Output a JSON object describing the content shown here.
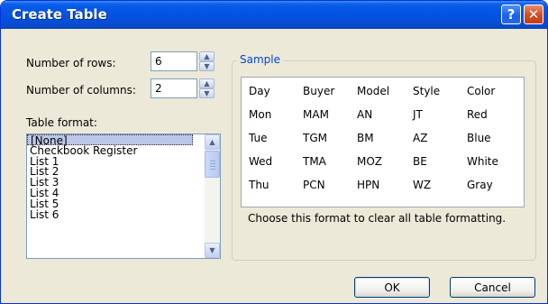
{
  "window": {
    "title": "Create Table",
    "help_label": "?",
    "close_label": "✕"
  },
  "rows": {
    "label": "Number of rows:",
    "value": "6"
  },
  "columns": {
    "label": "Number of columns:",
    "value": "2"
  },
  "table_format": {
    "label": "Table format:",
    "items": [
      "[None]",
      "Checkbook Register",
      "List 1",
      "List 2",
      "List 3",
      "List 4",
      "List 5",
      "List 6"
    ],
    "selected": "[None]"
  },
  "sample": {
    "title": "Sample",
    "grid": [
      [
        "Day",
        "Buyer",
        "Model",
        "Style",
        "Color"
      ],
      [
        "Mon",
        "MAM",
        "AN",
        "JT",
        "Red"
      ],
      [
        "Tue",
        "TGM",
        "BM",
        "AZ",
        "Blue"
      ],
      [
        "Wed",
        "TMA",
        "MOZ",
        "BE",
        "White"
      ],
      [
        "Thu",
        "PCN",
        "HPN",
        "WZ",
        "Gray"
      ]
    ],
    "description": "Choose this format to clear all table formatting."
  },
  "buttons": {
    "ok": "OK",
    "cancel": "Cancel"
  },
  "icons": {
    "spin_up": "▲",
    "spin_down": "▼",
    "scroll_up": "chevron-up-icon",
    "scroll_down": "chevron-down-icon"
  },
  "colors": {
    "titlebar": "#0554e3",
    "accent": "#0046d5",
    "dialog_bg": "#ece9d8"
  }
}
